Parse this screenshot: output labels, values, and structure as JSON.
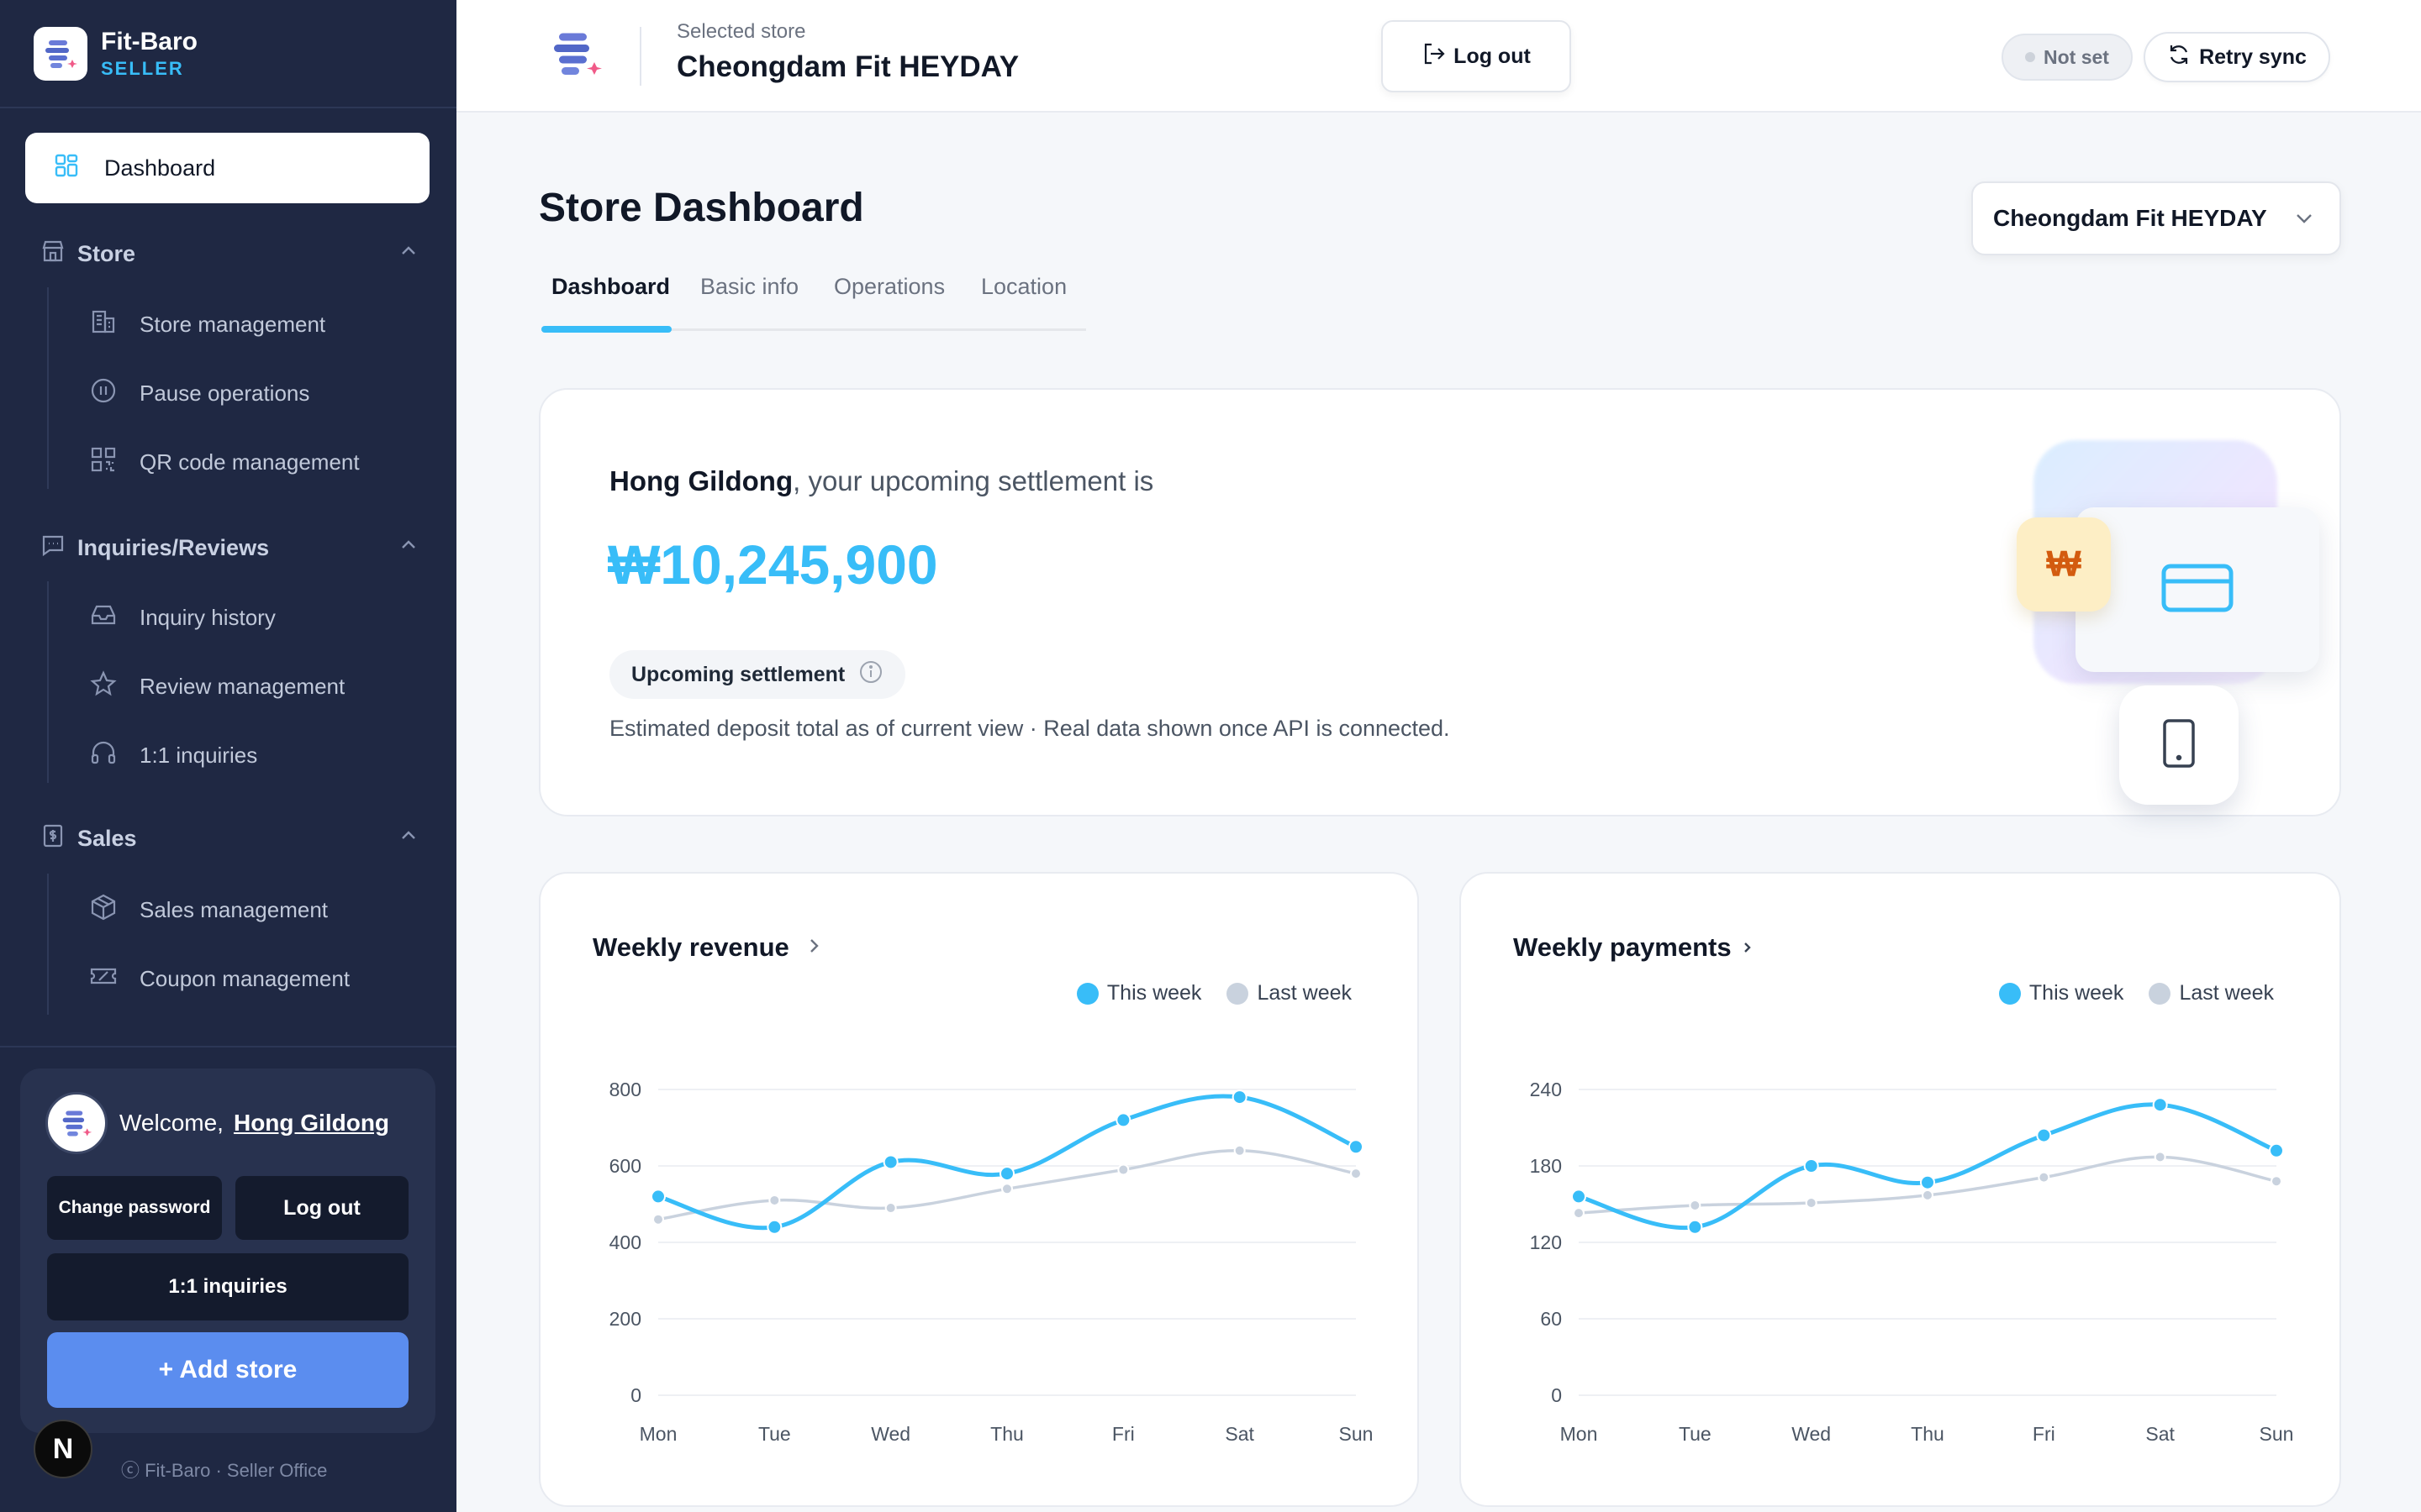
{
  "brand": {
    "name": "Fit-Baro",
    "sub": "SELLER"
  },
  "sidebar": {
    "active": {
      "label": "Dashboard",
      "icon": "grid-icon"
    },
    "sections": [
      {
        "label": "Store",
        "icon": "store-icon",
        "items": [
          {
            "label": "Store management",
            "icon": "building-icon"
          },
          {
            "label": "Pause operations",
            "icon": "pause-circle-icon"
          },
          {
            "label": "QR code management",
            "icon": "qr-code-icon"
          }
        ]
      },
      {
        "label": "Inquiries/Reviews",
        "icon": "message-square-icon",
        "items": [
          {
            "label": "Inquiry history",
            "icon": "inbox-icon"
          },
          {
            "label": "Review management",
            "icon": "star-icon"
          },
          {
            "label": "1:1 inquiries",
            "icon": "headphones-icon"
          }
        ]
      },
      {
        "label": "Sales",
        "icon": "receipt-icon",
        "items": [
          {
            "label": "Sales management",
            "icon": "box-icon"
          },
          {
            "label": "Coupon management",
            "icon": "ticket-icon"
          }
        ]
      }
    ],
    "user": {
      "welcome": "Welcome,",
      "name": "Hong Gildong",
      "change_password": "Change password",
      "logout": "Log out",
      "inquiries": "1:1 inquiries",
      "add_store": "+ Add store"
    },
    "n_badge": "N",
    "footer": "ⓒ Fit-Baro · Seller Office"
  },
  "topbar": {
    "selected_label": "Selected store",
    "selected_store": "Cheongdam Fit HEYDAY",
    "logout": "Log out",
    "status": "Not set",
    "retry": "Retry sync"
  },
  "main": {
    "title": "Store Dashboard",
    "store_select": "Cheongdam Fit HEYDAY",
    "tabs": [
      "Dashboard",
      "Basic info",
      "Operations",
      "Location"
    ],
    "active_tab": "Dashboard",
    "settlement": {
      "name": "Hong Gildong",
      "greeting_suffix": ", your upcoming settlement is",
      "amount": "₩10,245,900",
      "chip": "Upcoming settlement",
      "note": "Estimated deposit total as of current view · Real data shown once API is connected.",
      "badge_symbol": "₩"
    }
  },
  "colors": {
    "accent": "#38bdf8",
    "this_week": "#38bdf8",
    "last_week": "#c9d2de",
    "sidebar_bg": "#1f2843",
    "add_store": "#5b8def"
  },
  "chart_data": [
    {
      "type": "line",
      "title": "Weekly revenue",
      "categories": [
        "Mon",
        "Tue",
        "Wed",
        "Thu",
        "Fri",
        "Sat",
        "Sun"
      ],
      "ylim": [
        0,
        800
      ],
      "yticks": [
        0,
        200,
        400,
        600,
        800
      ],
      "grid": true,
      "legend": "top-right",
      "series": [
        {
          "name": "This week",
          "values": [
            520,
            440,
            610,
            580,
            720,
            780,
            650
          ]
        },
        {
          "name": "Last week",
          "values": [
            460,
            510,
            490,
            540,
            590,
            640,
            580
          ]
        }
      ]
    },
    {
      "type": "line",
      "title": "Weekly payments",
      "categories": [
        "Mon",
        "Tue",
        "Wed",
        "Thu",
        "Fri",
        "Sat",
        "Sun"
      ],
      "ylim": [
        0,
        240
      ],
      "yticks": [
        0,
        60,
        120,
        180,
        240
      ],
      "grid": true,
      "legend": "top-right",
      "series": [
        {
          "name": "This week",
          "values": [
            156,
            132,
            180,
            167,
            204,
            228,
            192
          ]
        },
        {
          "name": "Last week",
          "values": [
            143,
            149,
            151,
            157,
            171,
            187,
            168
          ]
        }
      ]
    }
  ]
}
